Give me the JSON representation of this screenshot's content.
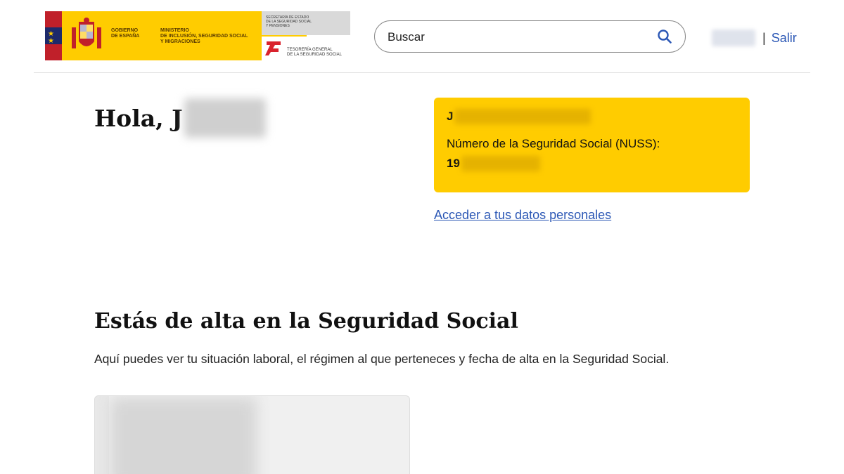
{
  "header": {
    "logo": {
      "gov_line1": "GOBIERNO",
      "gov_line2": "DE ESPAÑA",
      "ministry_line1": "MINISTERIO",
      "ministry_line2": "DE INCLUSIÓN, SEGURIDAD SOCIAL",
      "ministry_line3": "Y MIGRACIONES",
      "secretary_line1": "SECRETARÍA DE ESTADO",
      "secretary_line2": "DE LA SEGURIDAD SOCIAL",
      "secretary_line3": "Y PENSIONES",
      "tgss_line1": "TESORERÍA GENERAL",
      "tgss_line2": "DE LA SEGURIDAD SOCIAL"
    },
    "search": {
      "placeholder": "Buscar",
      "icon": "search-icon"
    },
    "separator": "|",
    "logout_label": "Salir"
  },
  "greeting": {
    "text": "Hola, J"
  },
  "card": {
    "name_initial": "J",
    "nuss_label": "Número de la Seguridad Social (NUSS):",
    "nuss_prefix": "19"
  },
  "personal_data_link": "Acceder a tus datos personales",
  "section": {
    "title": "Estás de alta en la Seguridad Social",
    "description": "Aquí puedes ver tu situación laboral, el régimen al que perteneces y fecha de alta en la Seguridad Social."
  },
  "colors": {
    "accent_yellow": "#ffcc00",
    "link_blue": "#2b57b5"
  }
}
